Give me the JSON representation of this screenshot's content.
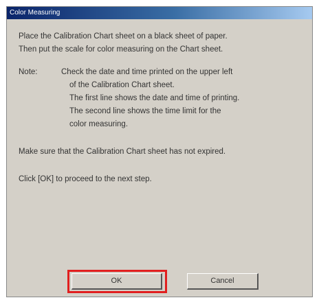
{
  "window": {
    "title": "Color Measuring"
  },
  "body": {
    "para1": [
      "Place the Calibration Chart sheet on a black sheet of paper.",
      "Then put the scale for color measuring on the Chart sheet."
    ],
    "note_label": "Note:",
    "note_lines": [
      "Check the date and time printed on the upper left",
      "of the Calibration Chart sheet.",
      "The first line shows the date and time of printing.",
      "The second line shows the time limit for the",
      "color measuring."
    ],
    "para3": "Make sure that the Calibration Chart sheet has not expired.",
    "para4": "Click [OK] to proceed to the next step."
  },
  "buttons": {
    "ok": "OK",
    "cancel": "Cancel"
  },
  "colors": {
    "highlight": "#e11f1f",
    "dialog_bg": "#d4d0c8",
    "titlebar": "#0a246a"
  }
}
